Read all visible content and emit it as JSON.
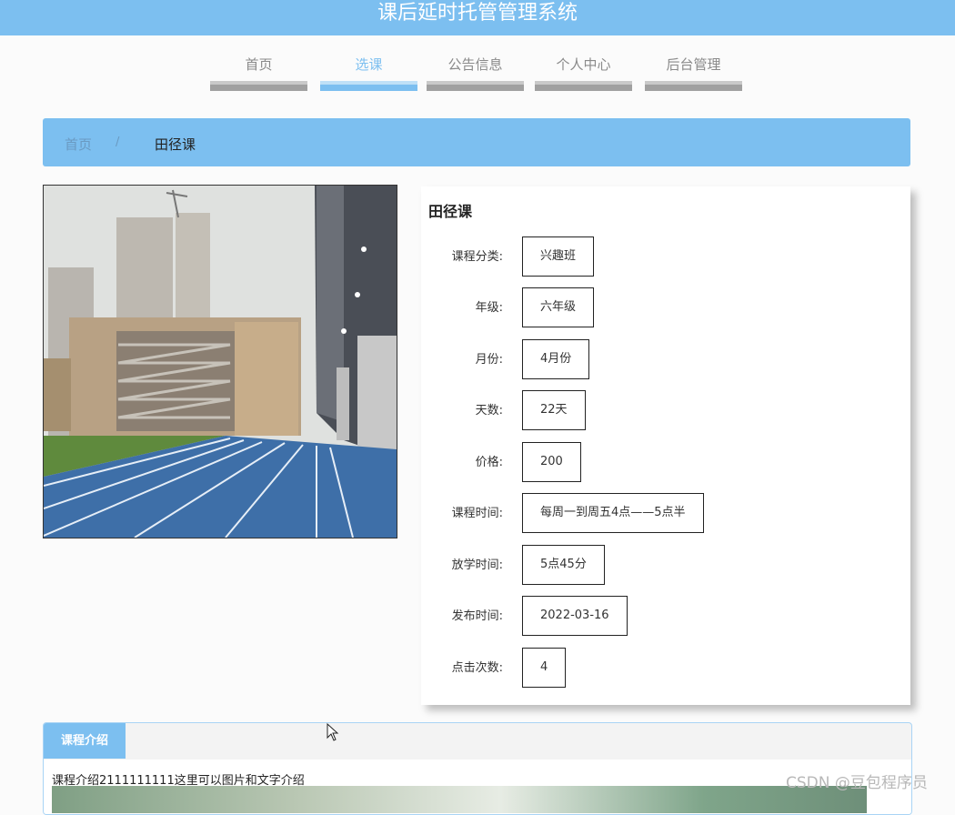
{
  "header": {
    "title": "课后延时托管管理系统"
  },
  "nav": [
    {
      "label": "首页",
      "active": false
    },
    {
      "label": "选课",
      "active": true
    },
    {
      "label": "公告信息",
      "active": false
    },
    {
      "label": "个人中心",
      "active": false
    },
    {
      "label": "后台管理",
      "active": false
    }
  ],
  "breadcrumb": {
    "home": "首页",
    "separator": "/",
    "current": "田径课"
  },
  "course": {
    "title": "田径课",
    "fields": [
      {
        "label": "课程分类:",
        "value": "兴趣班"
      },
      {
        "label": "年级:",
        "value": "六年级"
      },
      {
        "label": "月份:",
        "value": "4月份"
      },
      {
        "label": "天数:",
        "value": "22天"
      },
      {
        "label": "价格:",
        "value": "200"
      },
      {
        "label": "课程时间:",
        "value": "每周一到周五4点——5点半"
      },
      {
        "label": "放学时间:",
        "value": "5点45分"
      },
      {
        "label": "发布时间:",
        "value": "2022-03-16"
      },
      {
        "label": "点击次数:",
        "value": "4"
      }
    ]
  },
  "intro": {
    "tab_label": "课程介绍",
    "text": "课程介绍2111111111这里可以图片和文字介绍"
  },
  "watermark": "CSDN @豆包程序员",
  "colors": {
    "accent": "#7cbff0",
    "nav_inactive_bar": "#a0a0a0"
  }
}
